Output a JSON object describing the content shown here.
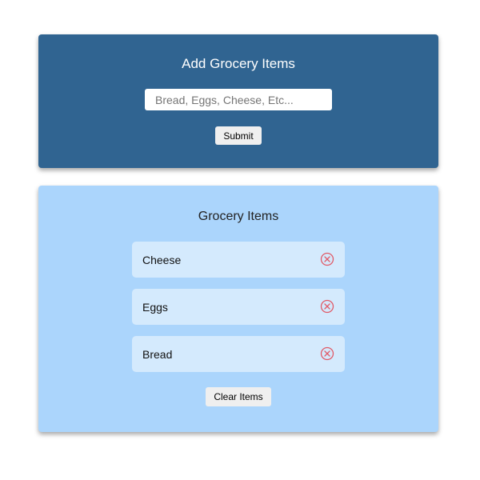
{
  "add_section": {
    "title": "Add Grocery Items",
    "input_value": "",
    "input_placeholder": "Bread, Eggs, Cheese, Etc...",
    "submit_label": "Submit"
  },
  "list_section": {
    "title": "Grocery Items",
    "items": [
      {
        "label": "Cheese",
        "remove_icon": "circle-x-icon"
      },
      {
        "label": "Eggs",
        "remove_icon": "circle-x-icon"
      },
      {
        "label": "Bread",
        "remove_icon": "circle-x-icon"
      }
    ],
    "clear_label": "Clear Items"
  },
  "colors": {
    "add_card_bg": "#306491",
    "list_card_bg": "#abd5fc",
    "item_bg": "#d4eafd",
    "remove_icon": "#e05a67"
  }
}
